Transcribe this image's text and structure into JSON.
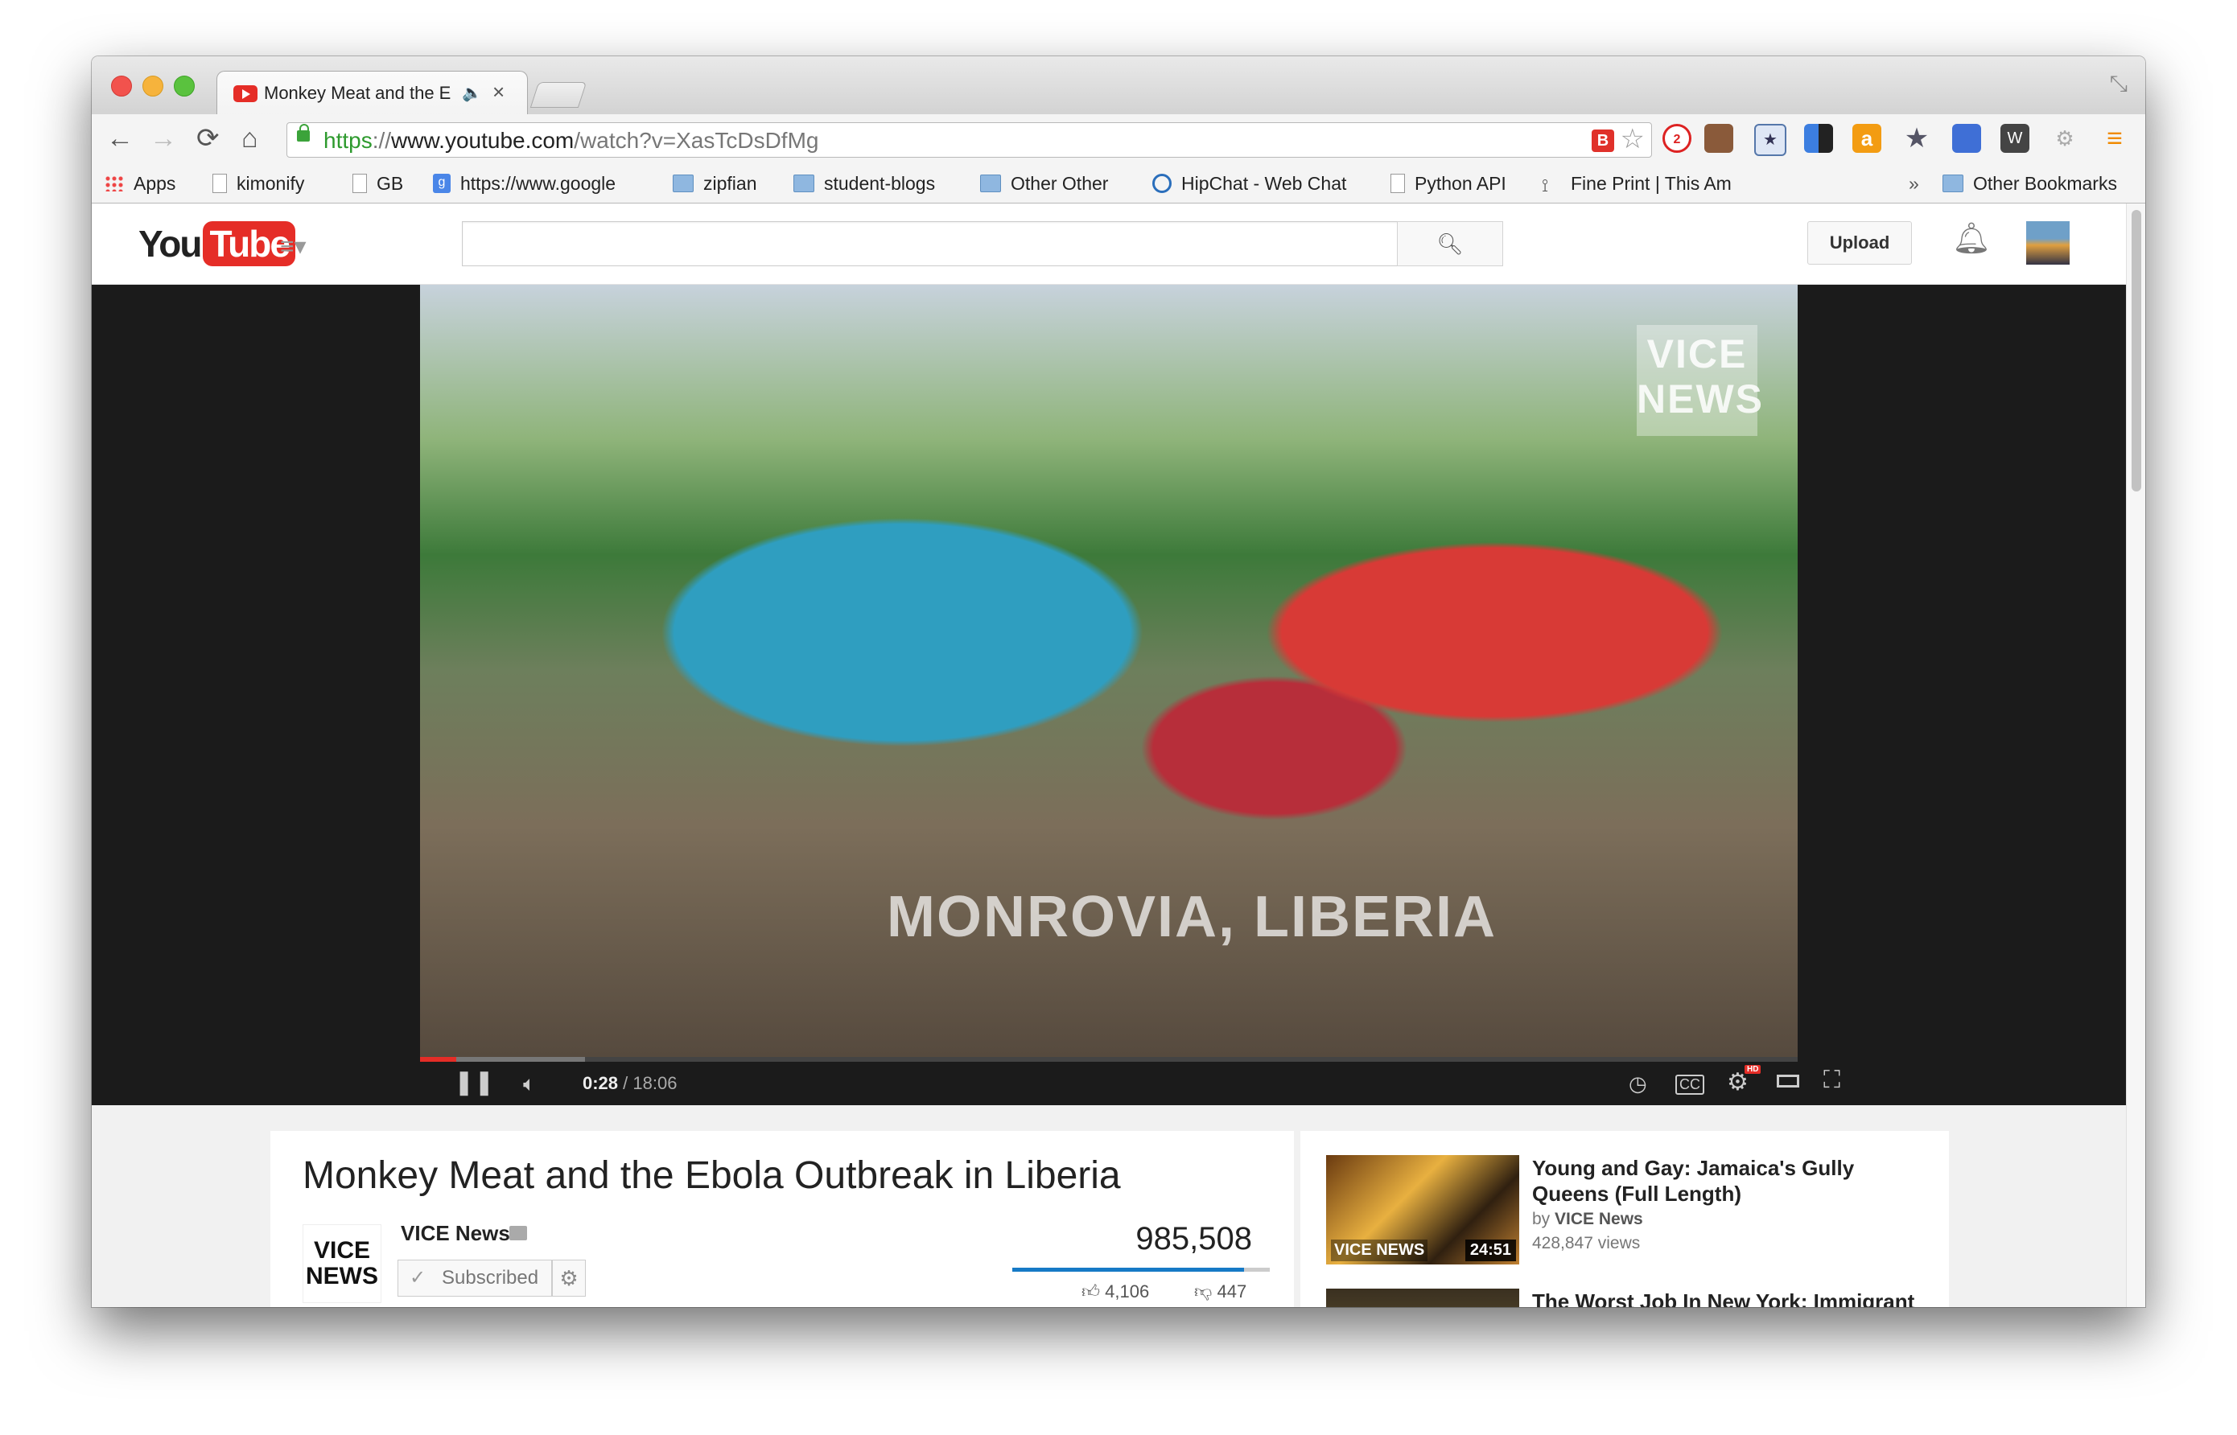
{
  "browser": {
    "tab": {
      "title": "Monkey Meat and the E",
      "close": "×"
    },
    "nav": {
      "back": "←",
      "forward": "→",
      "reload": "⟳",
      "home": "⌂"
    },
    "url": {
      "scheme": "https",
      "sep": "://",
      "host": "www.youtube.com",
      "path": "/watch?v=XasTcDsDfMg"
    },
    "extension_badge": "2",
    "bookmarks": [
      {
        "label": "Apps",
        "icon": "apps-grid-icon"
      },
      {
        "label": "kimonify",
        "icon": "page-icon"
      },
      {
        "label": "GB",
        "icon": "page-icon"
      },
      {
        "label": "https://www.google",
        "icon": "google-icon"
      },
      {
        "label": "zipfian",
        "icon": "folder-icon"
      },
      {
        "label": "student-blogs",
        "icon": "folder-icon"
      },
      {
        "label": "Other Other",
        "icon": "folder-icon"
      },
      {
        "label": "HipChat - Web Chat",
        "icon": "hipchat-icon"
      },
      {
        "label": "Python API",
        "icon": "page-icon"
      },
      {
        "label": "Fine Print | This Am",
        "icon": "rss-icon"
      }
    ],
    "bookmarks_overflow": "»",
    "other_bookmarks": "Other Bookmarks"
  },
  "youtube": {
    "logo_you": "You",
    "logo_tube": "Tube",
    "search_placeholder": "",
    "upload_label": "Upload",
    "player": {
      "watermark": "VICE NEWS",
      "caption": "MONROVIA, LIBERIA",
      "current_time": "0:28",
      "duration": " / 18:06",
      "played_fraction": 0.026,
      "buffered_fraction": 0.12,
      "hd_badge": "HD"
    },
    "video": {
      "title": "Monkey Meat and the Ebola Outbreak in Liberia",
      "channel_logo": "VICE NEWS",
      "channel_name": "VICE News",
      "subscribed_label": "Subscribed",
      "views": "985,508",
      "likes": "4,106",
      "dislikes": "447",
      "like_ratio": 0.9
    },
    "related": [
      {
        "title": "Young and Gay: Jamaica's Gully Queens (Full Length)",
        "by_prefix": "by ",
        "channel": "VICE News",
        "views": "428,847 views",
        "duration": "24:51",
        "thumb_brand": "VICE NEWS"
      },
      {
        "title": "The Worst Job In New York: Immigrant"
      }
    ]
  },
  "colors": {
    "accent": "#e52d27",
    "link_blue": "#167ac6",
    "secure_green": "#2e9a2e"
  }
}
